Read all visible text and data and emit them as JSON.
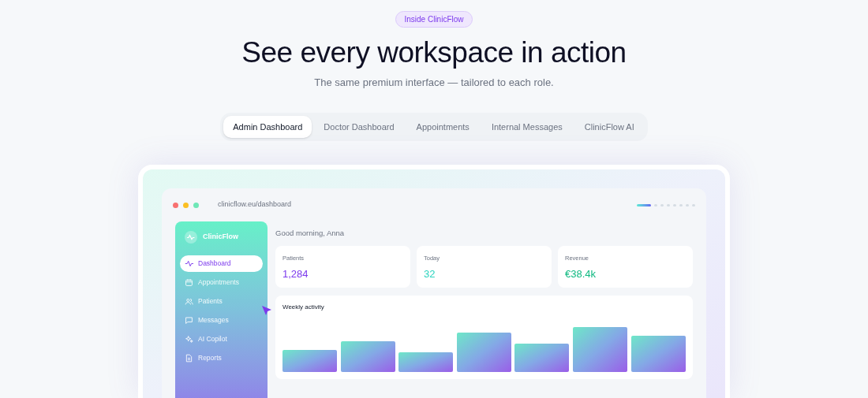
{
  "badge": "Inside ClinicFlow",
  "heading": "See every workspace in action",
  "subheading": "The same premium interface — tailored to each role.",
  "tabs": [
    {
      "label": "Admin Dashboard",
      "selected": true
    },
    {
      "label": "Doctor Dashboard",
      "selected": false
    },
    {
      "label": "Appointments",
      "selected": false
    },
    {
      "label": "Internal Messages",
      "selected": false
    },
    {
      "label": "ClinicFlow AI",
      "selected": false
    }
  ],
  "preview": {
    "url": "clinicflow.eu/dashboard",
    "slides": [
      {
        "selected": true
      },
      {
        "selected": false
      },
      {
        "selected": false
      },
      {
        "selected": false
      },
      {
        "selected": false
      },
      {
        "selected": false
      },
      {
        "selected": false
      },
      {
        "selected": false
      }
    ],
    "sidebar": {
      "brand": "ClinicFlow",
      "items": [
        {
          "label": "Dashboard",
          "selected": true
        },
        {
          "label": "Appointments",
          "selected": false
        },
        {
          "label": "Patients",
          "selected": false
        },
        {
          "label": "Messages",
          "selected": false
        },
        {
          "label": "AI Copilot",
          "selected": false
        },
        {
          "label": "Reports",
          "selected": false
        }
      ]
    },
    "greeting": "Good morning, Anna",
    "stats": [
      {
        "label": "Patients",
        "value": "1,284",
        "color": "#7c3aed"
      },
      {
        "label": "Today",
        "value": "32",
        "color": "#2dd4bf"
      },
      {
        "label": "Revenue",
        "value": "€38.4k",
        "color": "#10b981"
      }
    ],
    "chart": {
      "title": "Weekly activity"
    }
  }
}
